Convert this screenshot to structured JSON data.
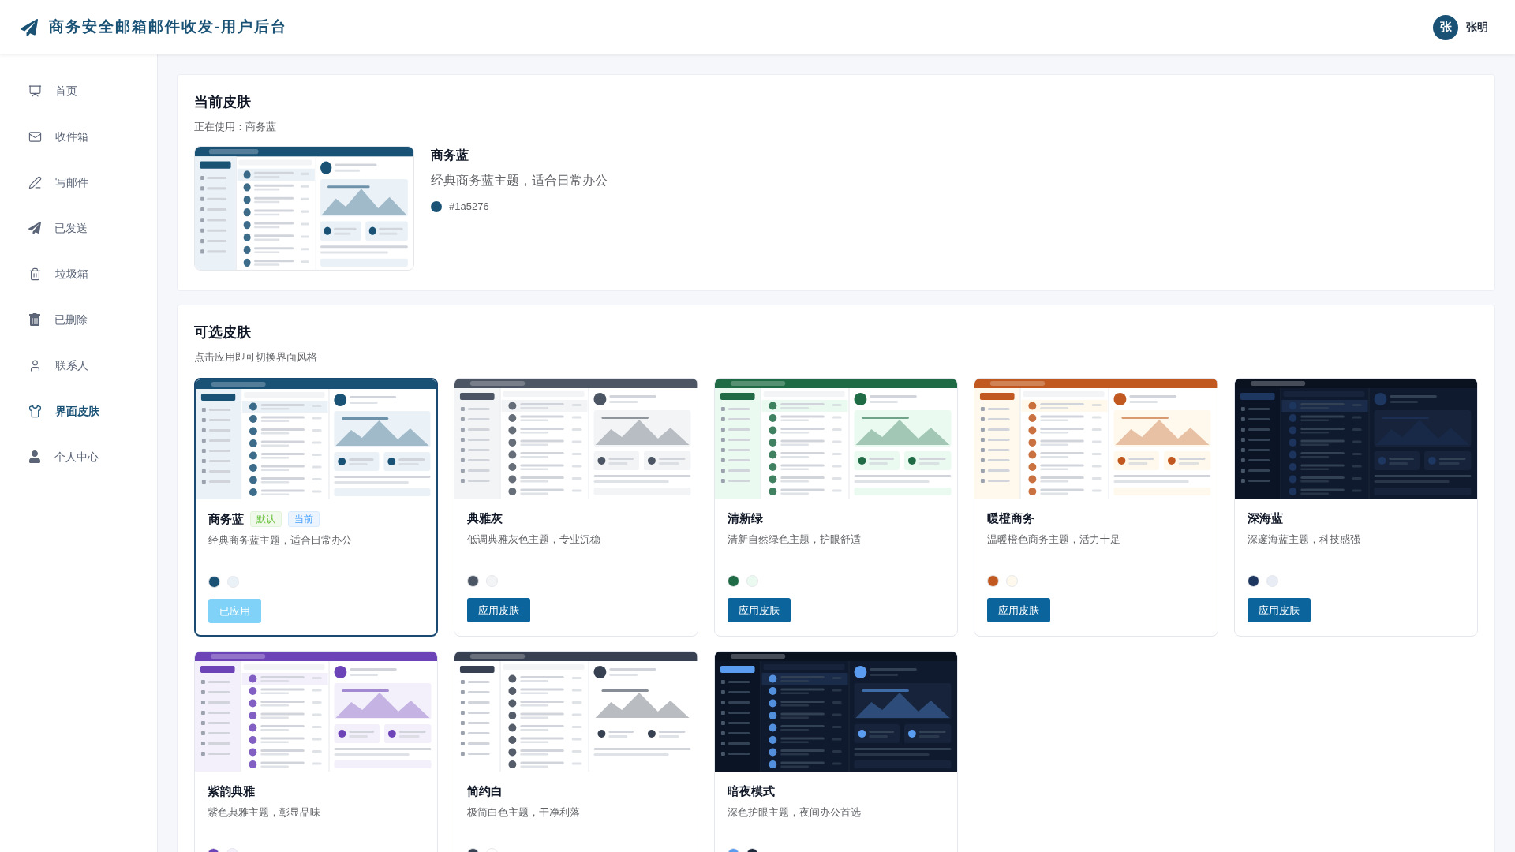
{
  "header": {
    "title": "商务安全邮箱邮件收发-用户后台",
    "user": {
      "avatar": "张",
      "name": "张明"
    }
  },
  "sidebar": {
    "items": [
      {
        "label": "首页",
        "kind": "home",
        "selected": false
      },
      {
        "label": "收件箱",
        "kind": "inbox",
        "selected": false
      },
      {
        "label": "写邮件",
        "kind": "compose",
        "selected": false
      },
      {
        "label": "已发送",
        "kind": "sent",
        "selected": false
      },
      {
        "label": "垃圾箱",
        "kind": "spam",
        "selected": false
      },
      {
        "label": "已删除",
        "kind": "deleted",
        "selected": false
      },
      {
        "label": "联系人",
        "kind": "contacts",
        "selected": false
      },
      {
        "label": "界面皮肤",
        "kind": "skin",
        "selected": true
      },
      {
        "label": "个人中心",
        "kind": "profile",
        "selected": false
      }
    ]
  },
  "current_skin": {
    "title": "当前皮肤",
    "subtitle": "正在使用：商务蓝",
    "dark_preview": false,
    "name": "商务蓝",
    "description": "经典商务蓝主题，适合日常办公",
    "swatch": {
      "color": "#1a5276",
      "label": "#1a5276"
    }
  },
  "skins": {
    "title": "可选皮肤",
    "subtitle": "点击应用即可切换界面风格",
    "items": [
      {
        "name": "商务蓝",
        "tags": [
          {
            "label": "默认",
            "kind": "success"
          },
          {
            "label": "当前",
            "kind": "info"
          }
        ],
        "description": "经典商务蓝主题，适合日常办公",
        "dark_preview": false,
        "swatches": [
          {
            "color": "#1a5276"
          },
          {
            "color": "#eaf2f8"
          }
        ],
        "selected": true,
        "button": {
          "label": "已应用",
          "disabled": true
        }
      },
      {
        "name": "典雅灰",
        "description": "低调典雅灰色主题，专业沉稳",
        "dark_preview": false,
        "swatches": [
          {
            "color": "#4b5563"
          },
          {
            "color": "#f3f4f6"
          }
        ],
        "selected": false,
        "button": {
          "label": "应用皮肤",
          "disabled": false
        }
      },
      {
        "name": "清新绿",
        "description": "清新自然绿色主题，护眼舒适",
        "dark_preview": false,
        "swatches": [
          {
            "color": "#1e6b45"
          },
          {
            "color": "#eafaf1"
          }
        ],
        "selected": false,
        "button": {
          "label": "应用皮肤",
          "disabled": false
        }
      },
      {
        "name": "暖橙商务",
        "description": "温暖橙色商务主题，活力十足",
        "dark_preview": false,
        "swatches": [
          {
            "color": "#c0581f"
          },
          {
            "color": "#fef9ec"
          }
        ],
        "selected": false,
        "button": {
          "label": "应用皮肤",
          "disabled": false
        }
      },
      {
        "name": "深海蓝",
        "description": "深邃海蓝主题，科技感强",
        "dark_preview": true,
        "swatches": [
          {
            "color": "#1e3760"
          },
          {
            "color": "#e8edf5"
          }
        ],
        "selected": false,
        "button": {
          "label": "应用皮肤",
          "disabled": false
        }
      },
      {
        "name": "紫韵典雅",
        "description": "紫色典雅主题，彰显品味",
        "dark_preview": false,
        "swatches": [
          {
            "color": "#6c44b8"
          },
          {
            "color": "#f3effb"
          }
        ],
        "selected": false
      },
      {
        "name": "简约白",
        "description": "极简白色主题，干净利落",
        "dark_preview": false,
        "swatches": [
          {
            "color": "#374151"
          },
          {
            "color": "#ffffff"
          }
        ],
        "selected": false
      },
      {
        "name": "暗夜模式",
        "description": "深色护眼主题，夜间办公首选",
        "dark_preview": true,
        "swatches": [
          {
            "color": "#5a9cf0"
          },
          {
            "color": "#1e293b"
          }
        ],
        "selected": false
      }
    ]
  }
}
